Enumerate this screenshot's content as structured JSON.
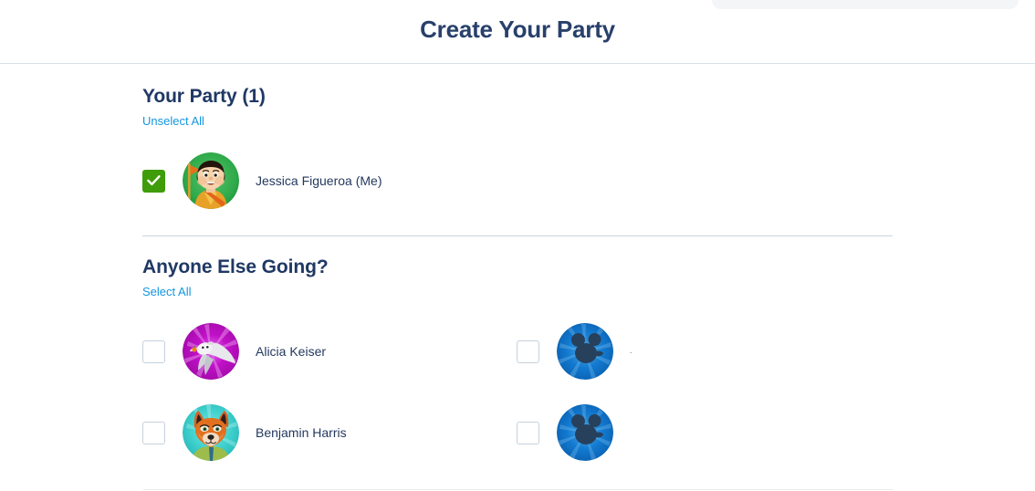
{
  "header": {
    "title": "Create Your Party"
  },
  "my_party": {
    "heading": "Your Party (1)",
    "toggle_label": "Unselect All",
    "members": [
      {
        "name": "Jessica Figueroa (Me)",
        "checked": true,
        "avatar": "russell-up-avatar",
        "avatar_bg": "#2faa4a"
      }
    ]
  },
  "others": {
    "heading": "Anyone Else Going?",
    "toggle_label": "Select All",
    "members": [
      {
        "name": "Alicia Keiser",
        "checked": false,
        "avatar": "zero-ghost-avatar",
        "avatar_bg": "#c111c7"
      },
      {
        "name": ".",
        "checked": false,
        "avatar": "mickey-default-avatar",
        "avatar_bg": "#1279cf"
      },
      {
        "name": "Benjamin Harris",
        "checked": false,
        "avatar": "nick-wilde-avatar",
        "avatar_bg": "#3fd0cd"
      },
      {
        "name": "",
        "checked": false,
        "avatar": "mickey-default-avatar",
        "avatar_bg": "#1279cf"
      }
    ]
  },
  "colors": {
    "title_navy": "#28406b",
    "link_blue": "#1496e0",
    "checkbox_green": "#3f9c0a",
    "divider": "#ccd5e0",
    "name_text": "#24395f"
  }
}
